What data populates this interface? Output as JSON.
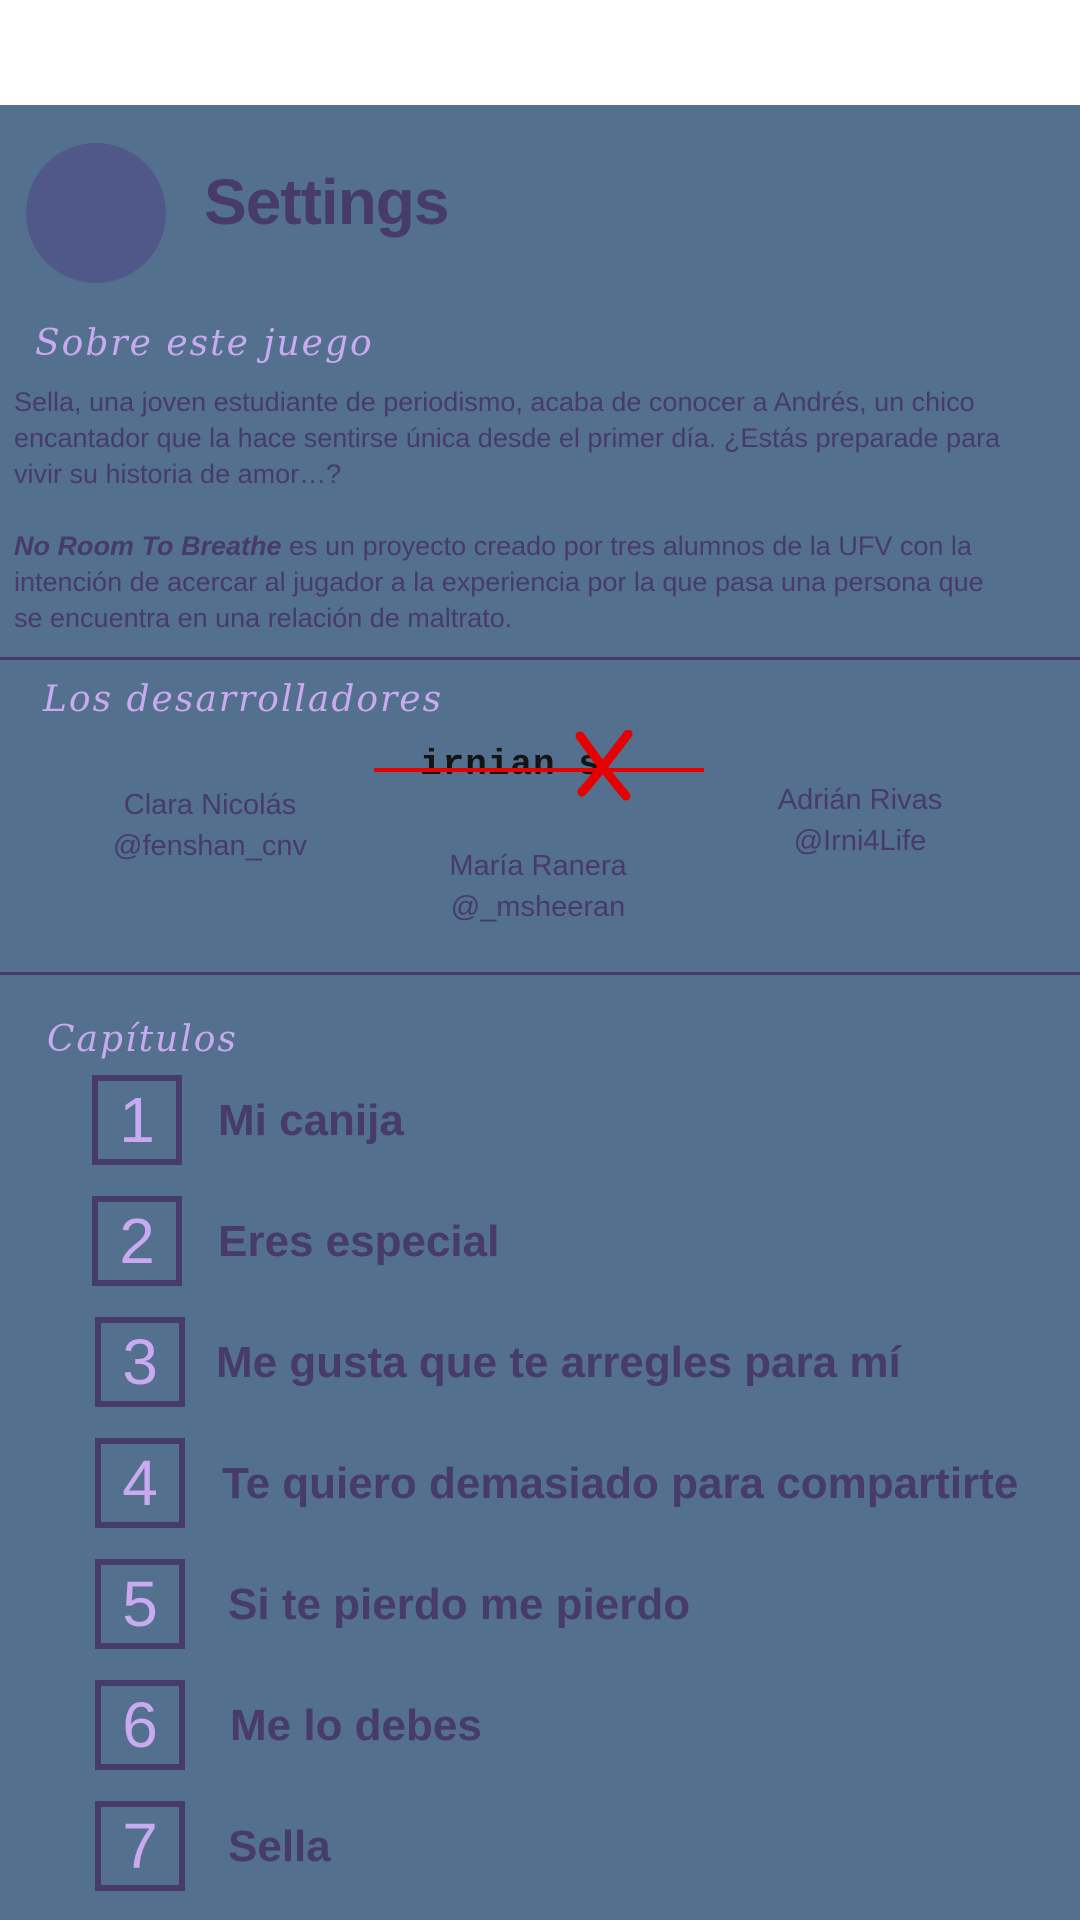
{
  "header": {
    "title": "Settings"
  },
  "about": {
    "heading": "Sobre este juego",
    "paragraph1": "Sella, una joven estudiante de periodismo, acaba de conocer a Andrés, un chico encantador que la hace sentirse única desde el primer día. ¿Estás preparade para vivir su historia de amor…?",
    "game_name": "No Room To Breathe",
    "paragraph2": " es un proyecto creado por  tres alumnos de la UFV con la intención de acercar al jugador a la experiencia por la que pasa una persona que se encuentra en una relación de maltrato."
  },
  "developers": {
    "heading": "Los desarrolladores",
    "logo_text": "irnianXs",
    "logo_word": "irnian s",
    "logo_x": "X",
    "people": [
      {
        "name": "Clara Nicolás",
        "handle": "@fenshan_cnv"
      },
      {
        "name": "María Ranera",
        "handle": "@_msheeran"
      },
      {
        "name": "Adrián Rivas",
        "handle": "@Irni4Life"
      }
    ]
  },
  "chapters": {
    "heading": "Capítulos",
    "items": [
      {
        "number": "1",
        "title": "Mi canija"
      },
      {
        "number": "2",
        "title": "Eres especial"
      },
      {
        "number": "3",
        "title": "Me gusta que te arregles para mí"
      },
      {
        "number": "4",
        "title": "Te quiero demasiado para compartirte"
      },
      {
        "number": "5",
        "title": "Si te pierdo me pierdo"
      },
      {
        "number": "6",
        "title": "Me lo debes"
      },
      {
        "number": "7",
        "title": "Sella"
      }
    ]
  },
  "colors": {
    "panel": "#53708e",
    "text_dark": "#473b6b",
    "accent_lilac": "#c9a9ef",
    "logo_red": "#e60000"
  }
}
